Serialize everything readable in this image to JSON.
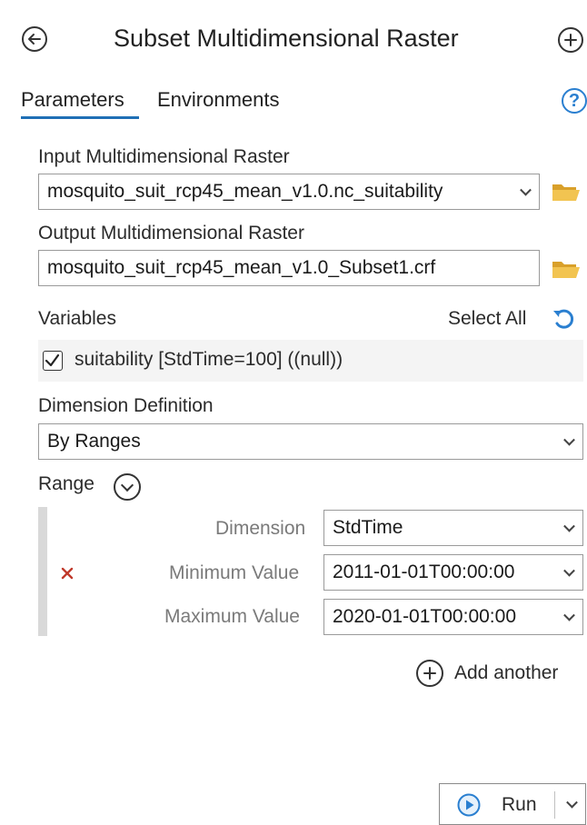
{
  "header": {
    "title": "Subset Multidimensional Raster",
    "back_icon": "back-arrow-circle-icon",
    "add_icon": "plus-circle-icon"
  },
  "tabs": [
    {
      "label": "Parameters",
      "active": true
    },
    {
      "label": "Environments",
      "active": false
    }
  ],
  "help_icon": "help-circle-icon",
  "input_raster": {
    "label": "Input Multidimensional Raster",
    "value": "mosquito_suit_rcp45_mean_v1.0.nc_suitability"
  },
  "output_raster": {
    "label": "Output Multidimensional Raster",
    "value": "mosquito_suit_rcp45_mean_v1.0_Subset1.crf"
  },
  "variables": {
    "label": "Variables",
    "select_all": "Select All",
    "items": [
      {
        "label": "suitability [StdTime=100] ((null))",
        "checked": true
      }
    ]
  },
  "dimension_definition": {
    "label": "Dimension Definition",
    "value": "By Ranges"
  },
  "range": {
    "label": "Range",
    "dimension_label": "Dimension",
    "dimension_value": "StdTime",
    "min_label": "Minimum Value",
    "min_value": "2011-01-01T00:00:00",
    "max_label": "Maximum Value",
    "max_value": "2020-01-01T00:00:00",
    "add_another": "Add another"
  },
  "run_button": {
    "label": "Run"
  },
  "colors": {
    "accent": "#1f6fb5",
    "folder": "#e8b53a",
    "remove": "#c0392b"
  }
}
